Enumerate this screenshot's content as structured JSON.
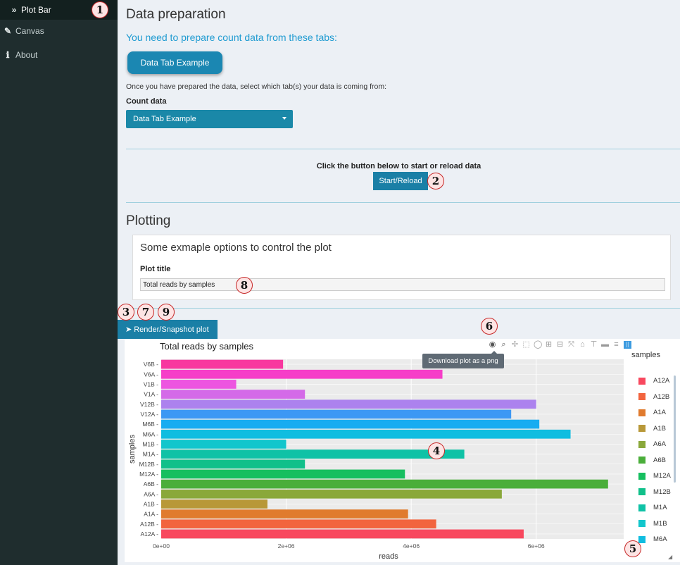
{
  "sidebar": {
    "items": [
      {
        "icon": "double-chevron-icon",
        "glyph": "»",
        "label": "Plot Bar"
      },
      {
        "icon": "brush-icon",
        "glyph": "🖌",
        "label": "Canvas"
      },
      {
        "icon": "info-icon",
        "glyph": "ℹ",
        "label": "About"
      }
    ]
  },
  "prep": {
    "title": "Data preparation",
    "hint": "You need to prepare count data from these tabs:",
    "tab_button": "Data Tab Example",
    "select_hint": "Once you have prepared the data, select which tab(s) your data is coming from:",
    "count_label": "Count data",
    "count_value": "Data Tab Example"
  },
  "start": {
    "hint": "Click the button below to start or reload data",
    "button": "Start/Reload"
  },
  "plotting": {
    "title": "Plotting",
    "options_title": "Some exmaple options to control the plot",
    "plot_title_label": "Plot title",
    "plot_title_value": "Total reads by samples",
    "render_button": "Render/Snapshot plot"
  },
  "tooltip": "Download plot as a png",
  "chart_data": {
    "type": "bar",
    "orientation": "horizontal",
    "title": "Total reads by samples",
    "xlabel": "reads",
    "ylabel": "samples",
    "xlim": [
      0,
      7400000
    ],
    "xticks": [
      "0e+00",
      "2e+06",
      "4e+06",
      "6e+06"
    ],
    "xtick_values": [
      0,
      2000000,
      4000000,
      6000000
    ],
    "categories": [
      "A12A",
      "A12B",
      "A1A",
      "A1B",
      "A6A",
      "A6B",
      "M12A",
      "M12B",
      "M1A",
      "M1B",
      "M6A",
      "M6B",
      "V12A",
      "V12B",
      "V1A",
      "V1B",
      "V6A",
      "V6B"
    ],
    "values": [
      5800000,
      4400000,
      3950000,
      1700000,
      5450000,
      7150000,
      3900000,
      2300000,
      4850000,
      2000000,
      6550000,
      6050000,
      5600000,
      6000000,
      2300000,
      1200000,
      4500000,
      1950000
    ],
    "colors": [
      "#f8485e",
      "#f2643e",
      "#e07b2e",
      "#b89838",
      "#8aa83a",
      "#4aae3a",
      "#16bf5f",
      "#10c08a",
      "#0fc2a6",
      "#12c6cc",
      "#10bde0",
      "#17acf1",
      "#3c98f4",
      "#ac82ee",
      "#d46ae8",
      "#ed55e0",
      "#f63ec8",
      "#f8379f"
    ],
    "legend_title": "samples",
    "legend_visible": [
      "A12A",
      "A12B",
      "A1A",
      "A1B",
      "A6A",
      "A6B",
      "M12A",
      "M12B",
      "M1A",
      "M1B",
      "M6A"
    ],
    "grid": true
  },
  "modebar": [
    "camera-icon",
    "zoom-icon",
    "pan-icon",
    "box-select-icon",
    "lasso-icon",
    "zoom-in-icon",
    "zoom-out-icon",
    "autoscale-icon",
    "reset-axes-icon",
    "spike-lines-icon",
    "hover-closest-icon",
    "hover-compare-icon",
    "plotly-logo-icon"
  ],
  "annotations": [
    "1",
    "2",
    "3",
    "7",
    "9",
    "4",
    "6",
    "8",
    "5"
  ]
}
